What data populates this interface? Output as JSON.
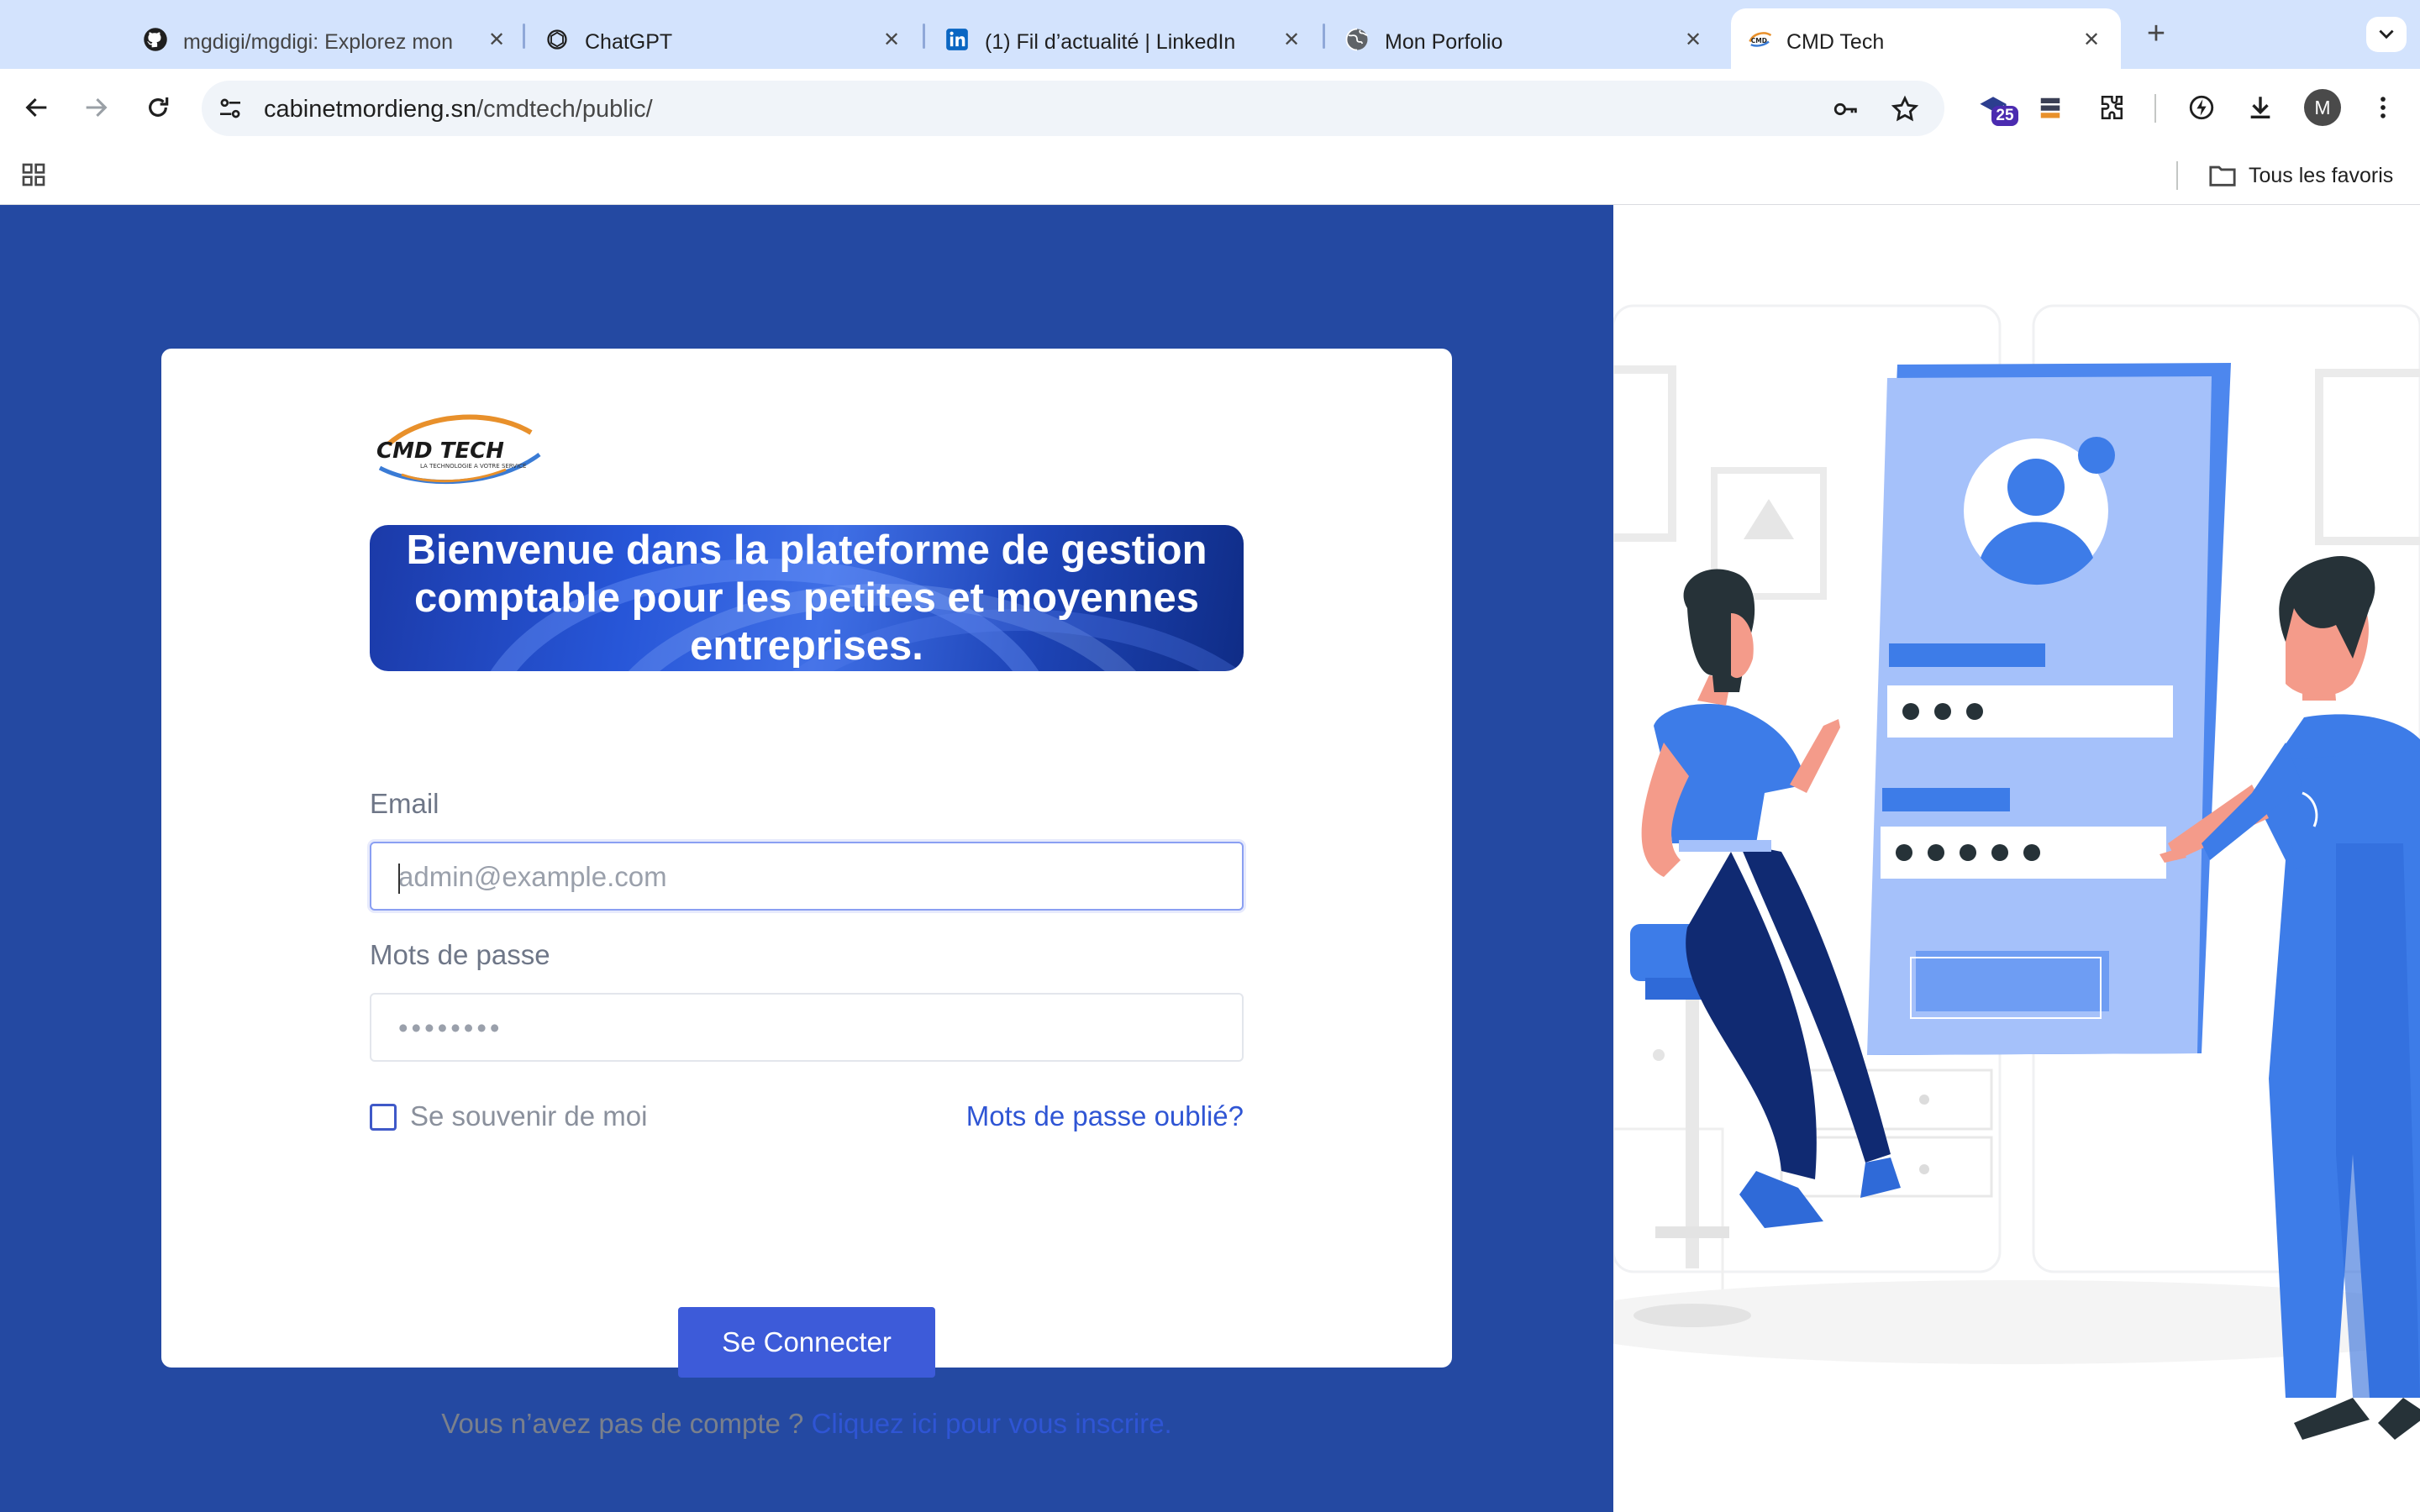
{
  "browser": {
    "tabs": [
      {
        "title": "mgdigi/mgdigi: Explorez mon",
        "icon": "github-icon"
      },
      {
        "title": "ChatGPT",
        "icon": "chatgpt-icon"
      },
      {
        "title": "(1) Fil d’actualité | LinkedIn",
        "icon": "linkedin-icon"
      },
      {
        "title": "Mon Porfolio",
        "icon": "globe-icon"
      },
      {
        "title": "CMD Tech",
        "icon": "cmdtech-favicon",
        "active": true
      }
    ],
    "address": {
      "domain": "cabinetmordieng.sn",
      "path": "/cmdtech/public/"
    },
    "extension_badge": "25",
    "profile_initial": "M",
    "bookmarks": {
      "all_favorites_label": "Tous les favoris"
    }
  },
  "page": {
    "logo_text": "CMD TECH",
    "logo_tagline": "LA TECHNOLOGIE A VOTRE SERVICE",
    "banner_text": "Bienvenue dans la plateforme de gestion comptable pour les petites et moyennes entreprises.",
    "email_label": "Email",
    "email_placeholder": "admin@example.com",
    "password_label": "Mots de passe",
    "password_value": "••••••••",
    "remember_label": "Se souvenir de moi",
    "forgot_link": "Mots de passe oublié?",
    "submit_label": "Se Connecter",
    "signup_prompt": "Vous n’avez pas de compte ?",
    "signup_link": "Cliquez ici pour vous inscrire."
  },
  "colors": {
    "left_panel": "#2449a2",
    "primary_button": "#3d5bd9",
    "link": "#2f55d4",
    "tab_strip": "#d3e3fd"
  }
}
